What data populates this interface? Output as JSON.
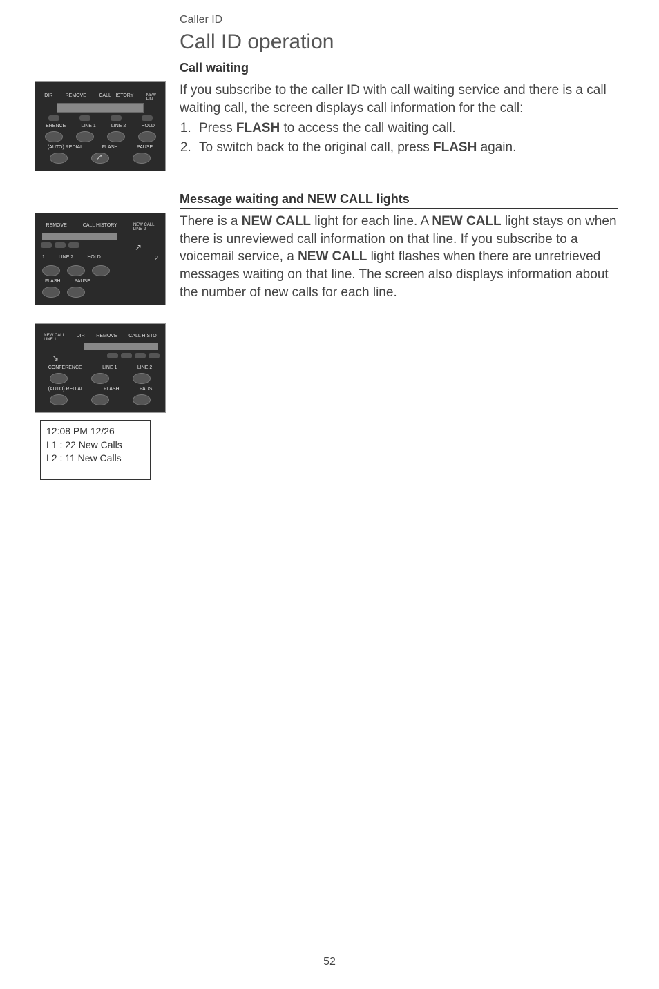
{
  "header": {
    "section_label": "Caller ID",
    "title": "Call ID operation"
  },
  "section1": {
    "heading": "Call waiting",
    "para": "If you subscribe to the caller ID with call waiting service and there is a call waiting call, the screen displays call information for the call:",
    "step1_pre": "Press ",
    "step1_bold": "FLASH",
    "step1_post": " to access the call waiting call.",
    "step2_pre": "To switch back to the original call, press ",
    "step2_bold": "FLASH",
    "step2_post": " again.",
    "panel": {
      "row1": [
        "DIR",
        "REMOVE",
        "CALL HISTORY",
        "NEW\nLIN"
      ],
      "row2": [
        "ERENCE",
        "LINE 1",
        "LINE 2",
        "HOLD"
      ],
      "row3": [
        "(AUTO) REDIAL",
        "FLASH",
        "PAUSE"
      ]
    }
  },
  "section2": {
    "heading": "Message waiting and NEW CALL lights",
    "para_parts": [
      {
        "t": "There is a "
      },
      {
        "b": "NEW CALL"
      },
      {
        "t": " light for each line. A "
      },
      {
        "b": "NEW CALL"
      },
      {
        "t": " light stays on when there is unreviewed call information on that line. If you subscribe to a voicemail service, a "
      },
      {
        "b": "NEW CALL"
      },
      {
        "t": " light flashes when there are unretrieved messages waiting on that line. The screen also displays information about the number of new calls for each line."
      }
    ],
    "panel_a": {
      "row1": [
        "REMOVE",
        "CALL HISTORY",
        "NEW CALL\nLINE 2"
      ],
      "row2": [
        "1",
        "LINE 2",
        "HOLD"
      ],
      "row3": [
        "FLASH",
        "PAUSE"
      ]
    },
    "panel_b": {
      "row1": [
        "NEW CALL\nLINE 1",
        "DIR",
        "REMOVE",
        "CALL HISTO"
      ],
      "row2": [
        "CONFERENCE",
        "LINE 1",
        "LINE 2"
      ],
      "row3": [
        "(AUTO) REDIAL",
        "FLASH",
        "PAUS"
      ]
    },
    "screen": {
      "line1": "12:08 PM  12/26",
      "line2": "L1 : 22 New Calls",
      "line3": "L2 : 11 New Calls"
    }
  },
  "page_number": "52"
}
